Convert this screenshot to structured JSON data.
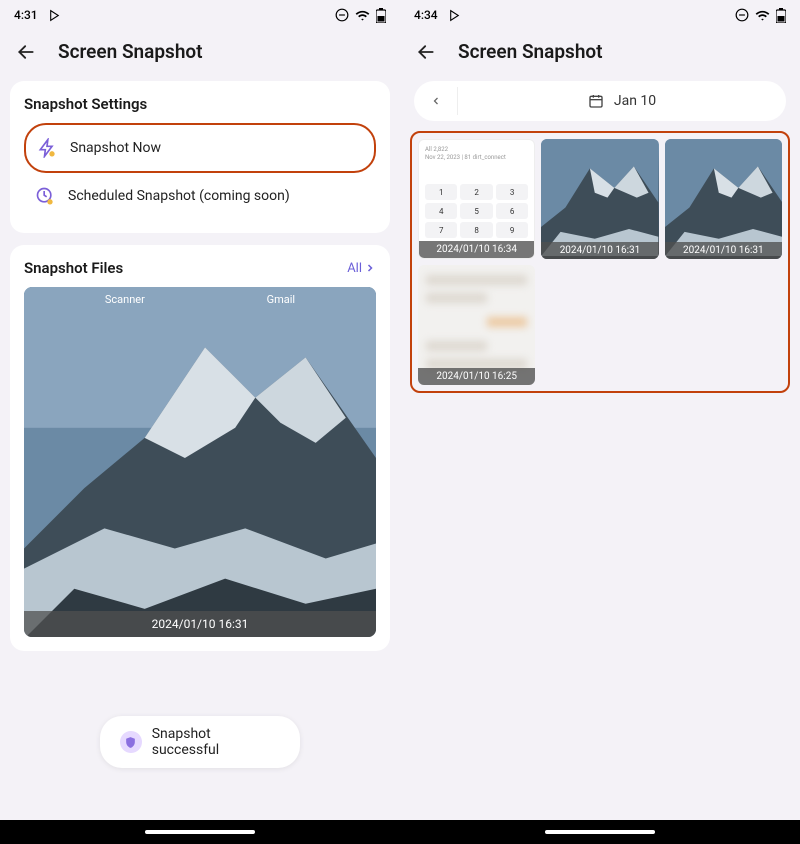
{
  "left": {
    "status_time": "4:31",
    "header_title": "Screen Snapshot",
    "settings_title": "Snapshot Settings",
    "snapshot_now_label": "Snapshot Now",
    "scheduled_label": "Scheduled Snapshot (coming soon)",
    "files_title": "Snapshot Files",
    "all_label": "All",
    "thumb_apps": {
      "app1": "Scanner",
      "app2": "Gmail"
    },
    "thumb_timestamp": "2024/01/10 16:31",
    "toast_text": "Snapshot successful"
  },
  "right": {
    "status_time": "4:34",
    "header_title": "Screen Snapshot",
    "date_label": "Jan 10",
    "thumbs": [
      {
        "ts": "2024/01/10 16:34"
      },
      {
        "ts": "2024/01/10 16:31"
      },
      {
        "ts": "2024/01/10 16:31"
      },
      {
        "ts": "2024/01/10 16:25"
      }
    ],
    "keypad_top_line1": "All 2,822",
    "keypad_top_line2": "Nov 22, 2023 | 81 dirt_connect"
  }
}
